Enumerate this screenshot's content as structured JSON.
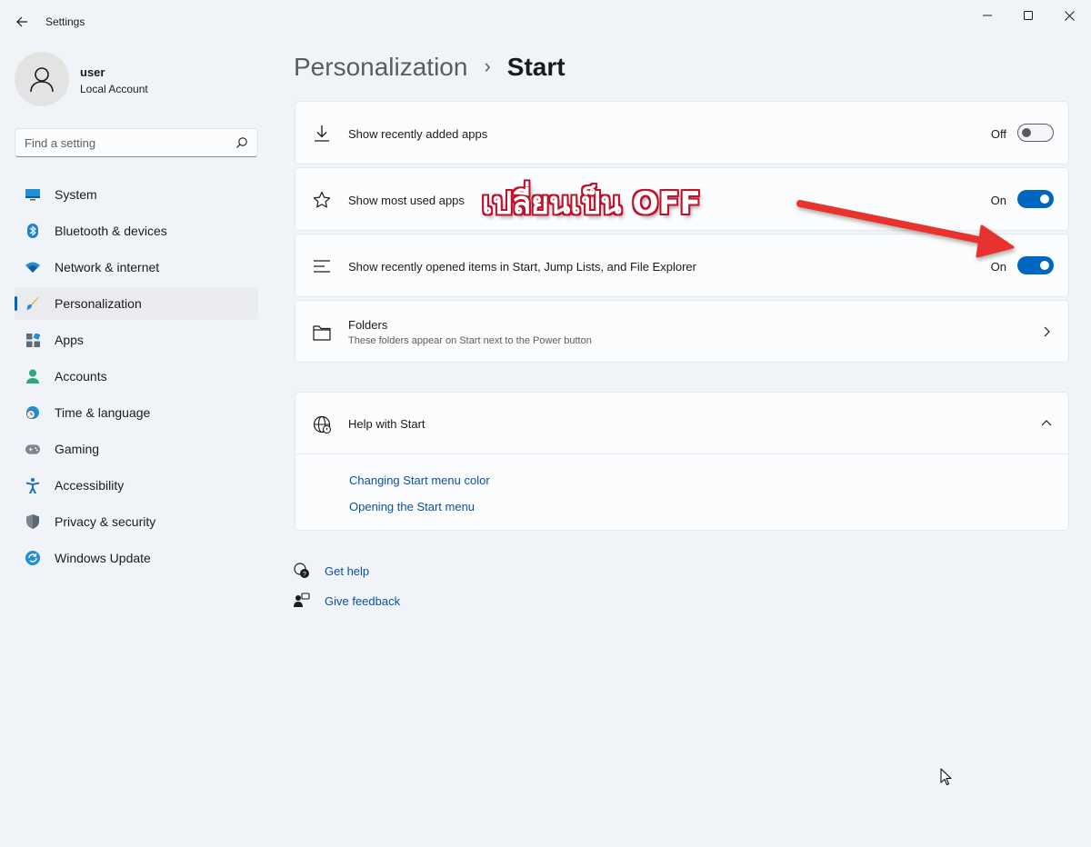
{
  "window": {
    "title": "Settings"
  },
  "user": {
    "name": "user",
    "account_type": "Local Account"
  },
  "search": {
    "placeholder": "Find a setting"
  },
  "sidebar": {
    "items": [
      {
        "label": "System",
        "icon": "monitor-icon"
      },
      {
        "label": "Bluetooth & devices",
        "icon": "bluetooth-icon"
      },
      {
        "label": "Network & internet",
        "icon": "wifi-icon"
      },
      {
        "label": "Personalization",
        "icon": "brush-icon",
        "active": true
      },
      {
        "label": "Apps",
        "icon": "apps-icon"
      },
      {
        "label": "Accounts",
        "icon": "person-icon"
      },
      {
        "label": "Time & language",
        "icon": "globe-clock-icon"
      },
      {
        "label": "Gaming",
        "icon": "gamepad-icon"
      },
      {
        "label": "Accessibility",
        "icon": "accessibility-icon"
      },
      {
        "label": "Privacy & security",
        "icon": "shield-icon"
      },
      {
        "label": "Windows Update",
        "icon": "update-icon"
      }
    ]
  },
  "breadcrumb": {
    "parent": "Personalization",
    "separator": "›",
    "current": "Start"
  },
  "settings": [
    {
      "label": "Show recently added apps",
      "state": "Off",
      "on": false,
      "icon": "download-icon"
    },
    {
      "label": "Show most used apps",
      "state": "On",
      "on": true,
      "icon": "star-icon"
    },
    {
      "label": "Show recently opened items in Start, Jump Lists, and File Explorer",
      "state": "On",
      "on": true,
      "icon": "list-icon"
    }
  ],
  "folders": {
    "label": "Folders",
    "description": "These folders appear on Start next to the Power button",
    "icon": "folder-icon"
  },
  "help": {
    "title": "Help with Start",
    "links": [
      "Changing Start menu color",
      "Opening the Start menu"
    ]
  },
  "footer_links": {
    "get_help": "Get help",
    "give_feedback": "Give feedback"
  },
  "annotation": {
    "text": "เปลี่ยนเป็น OFF",
    "color": "#e8332f"
  },
  "colors": {
    "accent": "#0067c0",
    "background": "#f0f4f9",
    "link": "#0a4f9e"
  }
}
